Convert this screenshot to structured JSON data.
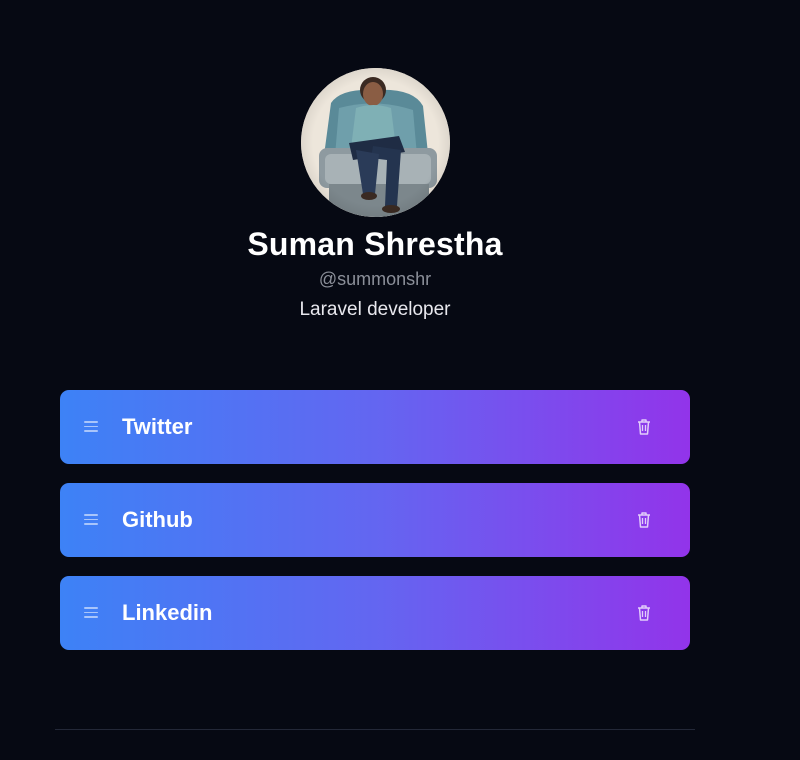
{
  "profile": {
    "name": "Suman Shrestha",
    "handle": "@summonshr",
    "bio": "Laravel developer"
  },
  "links": [
    {
      "label": "Twitter",
      "drag_icon": "drag-handle-icon",
      "delete_icon": "trash-icon"
    },
    {
      "label": "Github",
      "drag_icon": "drag-handle-icon",
      "delete_icon": "trash-icon"
    },
    {
      "label": "Linkedin",
      "drag_icon": "drag-handle-icon",
      "delete_icon": "trash-icon"
    }
  ],
  "colors": {
    "background": "#060913",
    "gradient_start": "#3d82f6",
    "gradient_end": "#9234ea",
    "handle_text": "#8b8f99"
  }
}
